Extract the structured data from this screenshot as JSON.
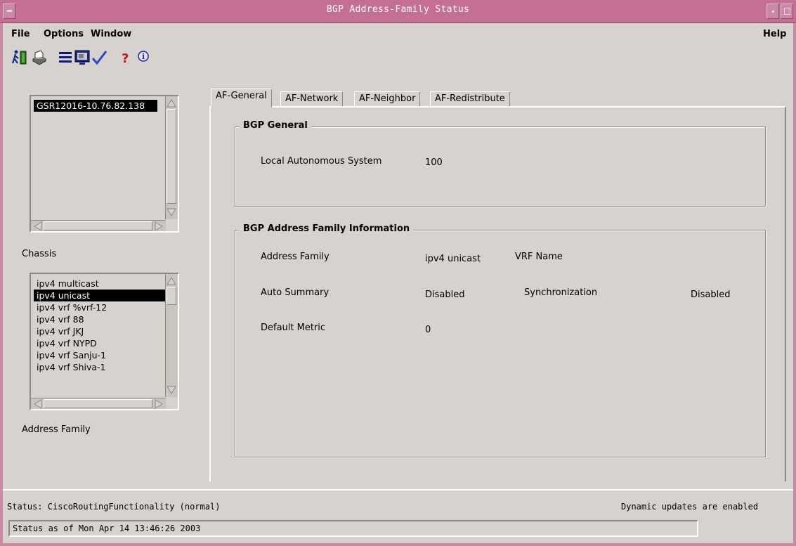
{
  "window": {
    "title": "BGP Address-Family Status"
  },
  "menu": {
    "file": "File",
    "options": "Options",
    "window": "Window",
    "help": "Help"
  },
  "toolbar": {
    "icons": [
      "exit-icon",
      "print-icon",
      "list-icon",
      "monitor-icon",
      "check-icon",
      "help-icon",
      "info-icon"
    ]
  },
  "chassis": {
    "items": [
      "GSR12016-10.76.82.138"
    ],
    "selected_index": 0,
    "label": "Chassis"
  },
  "address_family_list": {
    "items": [
      "ipv4 multicast",
      "ipv4 unicast",
      "ipv4 vrf %vrf-12",
      "ipv4 vrf 88",
      "ipv4 vrf JKJ",
      "ipv4 vrf NYPD",
      "ipv4 vrf Sanju-1",
      "ipv4 vrf Shiva-1"
    ],
    "selected_index": 1,
    "label": "Address Family"
  },
  "tabs": [
    "AF-General",
    "AF-Network",
    "AF-Neighbor",
    "AF-Redistribute"
  ],
  "active_tab": 0,
  "bgp_general": {
    "title": "BGP General",
    "las_label": "Local Autonomous System",
    "las_value": "100"
  },
  "af_info": {
    "title": "BGP Address Family Information",
    "af_label": "Address Family",
    "af_value": "ipv4 unicast",
    "vrf_label": "VRF Name",
    "vrf_value": "",
    "auto_label": "Auto Summary",
    "auto_value": "Disabled",
    "sync_label": "Synchronization",
    "sync_value": "Disabled",
    "metric_label": "Default Metric",
    "metric_value": "0"
  },
  "status": {
    "line1": "Status: CiscoRoutingFunctionality (normal)",
    "dynamic": "Dynamic updates are enabled",
    "line2": "Status as of Mon Apr 14 13:46:26 2003"
  },
  "colors": {
    "titlebar": "#c56f97",
    "background": "#d6d3ce",
    "selection": "#000000"
  }
}
